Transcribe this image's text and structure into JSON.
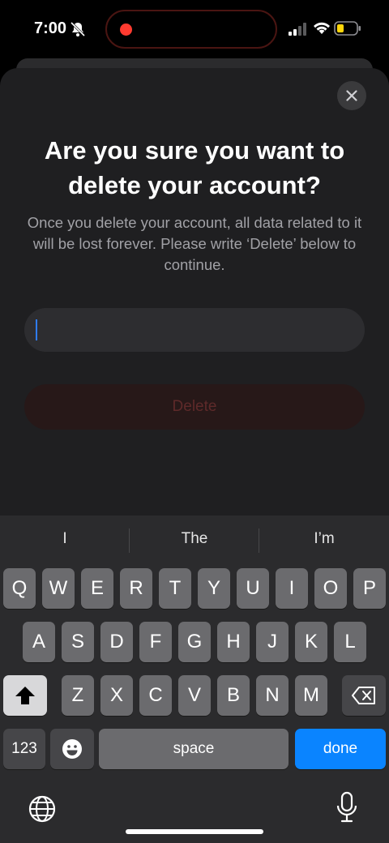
{
  "status_bar": {
    "time": "7:00"
  },
  "dialog": {
    "title": "Are you sure you want to delete your account?",
    "message": "Once you delete your account, all data related to it will be lost forever. Please write ‘Delete’ below to continue.",
    "input_value": "",
    "delete_label": "Delete"
  },
  "keyboard": {
    "suggestions": [
      "I",
      "The",
      "I’m"
    ],
    "row1": [
      "Q",
      "W",
      "E",
      "R",
      "T",
      "Y",
      "U",
      "I",
      "O",
      "P"
    ],
    "row2": [
      "A",
      "S",
      "D",
      "F",
      "G",
      "H",
      "J",
      "K",
      "L"
    ],
    "row3": [
      "Z",
      "X",
      "C",
      "V",
      "B",
      "N",
      "M"
    ],
    "numbers_label": "123",
    "space_label": "space",
    "done_label": "done"
  },
  "colors": {
    "accent": "#0a84ff",
    "destructive_disabled": "#5e2a2a",
    "record_dot": "#ff3b30"
  },
  "icons": [
    "bell-slash-icon",
    "signal-icon",
    "wifi-icon",
    "battery-icon",
    "close-icon",
    "shift-icon",
    "backspace-icon",
    "emoji-icon",
    "globe-icon",
    "mic-icon"
  ]
}
